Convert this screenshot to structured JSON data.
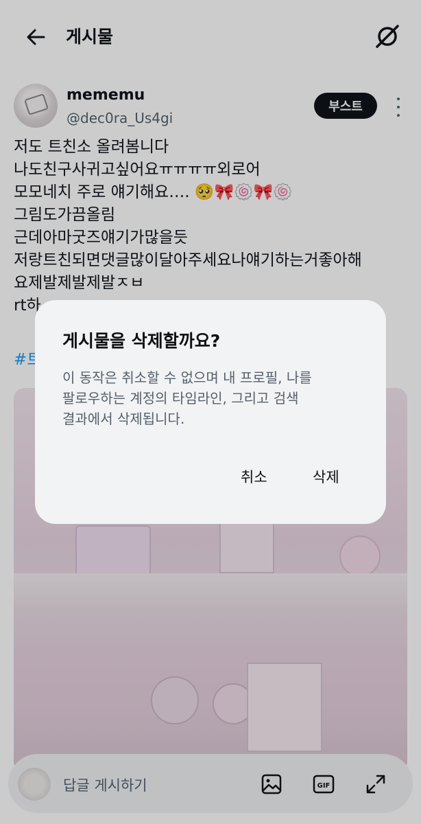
{
  "header": {
    "title": "게시물"
  },
  "post": {
    "author_name": "mememu",
    "author_handle": "@dec0ra_Us4gi",
    "boost_label": "부스트",
    "lines": [
      "저도 트친소 올려봄니다",
      "나도친구사귀고싶어요ㅠㅠㅠㅠ외로어",
      "모모네치 주로 얘기해요…. 🥺🎀🍥🎀🍥",
      "그림도가끔올림",
      "근데아마굿즈얘기가많을듯",
      "저랑트친되면댓글많이달아주세요나얘기하는거좋아해",
      "요제발제발제발ㅈㅂ",
      "rt하"
    ],
    "hashtag": "#트"
  },
  "reply": {
    "placeholder": "답글 게시하기"
  },
  "dialog": {
    "title": "게시물을 삭제할까요?",
    "message_lines": [
      "이 동작은 취소할 수 없으며 내 프로필, 나를",
      "팔로우하는 계정의 타임라인, 그리고 검색",
      "결과에서 삭제됩니다."
    ],
    "cancel_label": "취소",
    "delete_label": "삭제"
  },
  "colors": {
    "accent": "#1d9bf0",
    "text": "#0f1419",
    "muted": "#536471",
    "dialog_bg": "#f2f3f5"
  },
  "icons": [
    "back-arrow-icon",
    "grok-icon",
    "more-icon",
    "image-icon",
    "gif-icon",
    "expand-icon"
  ]
}
